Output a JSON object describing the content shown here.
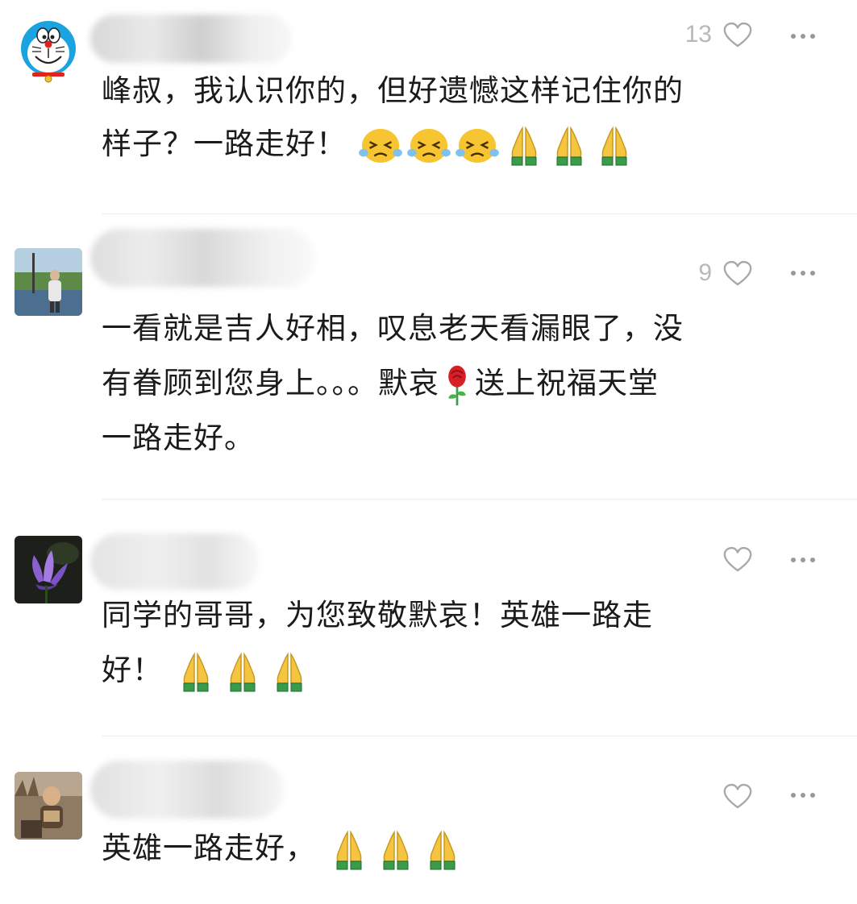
{
  "comments": [
    {
      "likes": "13",
      "line1": "峰叔，我认识你的，但好遗憾这样记住你的",
      "line2": "样子？一路走好！",
      "emojis": [
        "crying-face",
        "crying-face",
        "crying-face",
        "folded-hands",
        "folded-hands",
        "folded-hands"
      ]
    },
    {
      "likes": "9",
      "line1": "一看就是吉人好相，叹息老天看漏眼了，没",
      "line2a": "有眷顾到您身上。。。默哀",
      "line2b": "送上祝福天堂",
      "line3": "一路走好。",
      "emojis": [
        "rose"
      ]
    },
    {
      "likes": "",
      "line1": "同学的哥哥，为您致敬默哀！英雄一路走",
      "line2": "好！",
      "emojis": [
        "folded-hands",
        "folded-hands",
        "folded-hands"
      ]
    },
    {
      "likes": "",
      "line1": "英雄一路走好，",
      "emojis": [
        "folded-hands",
        "folded-hands",
        "folded-hands"
      ]
    }
  ],
  "colors": {
    "text": "#1b1b1b",
    "meta": "#b4b4b4",
    "divider": "#ececec"
  }
}
